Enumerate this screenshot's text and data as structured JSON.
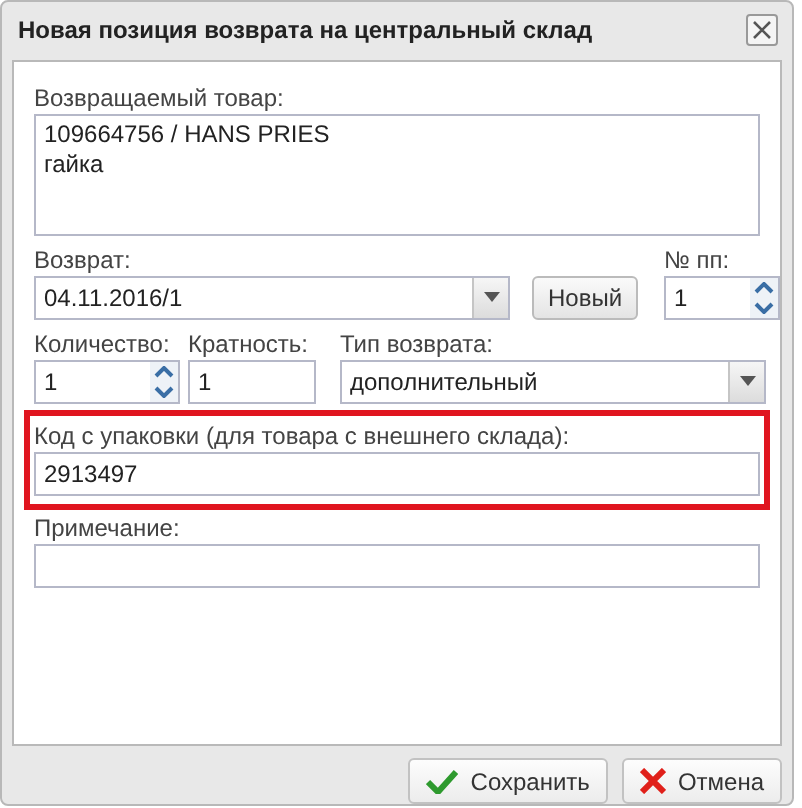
{
  "window": {
    "title": "Новая позиция возврата на центральный склад"
  },
  "product": {
    "label": "Возвращаемый товар:",
    "lines": [
      "109664756 / HANS PRIES",
      "гайка"
    ]
  },
  "return": {
    "label": "Возврат:",
    "value": "04.11.2016/1",
    "new_button": "Новый"
  },
  "number": {
    "label": "№ пп:",
    "value": "1"
  },
  "quantity": {
    "label": "Количество:",
    "value": "1"
  },
  "multiplicity": {
    "label": "Кратность:",
    "value": "1"
  },
  "return_type": {
    "label": "Тип возврата:",
    "value": "дополнительный"
  },
  "package_code": {
    "label": "Код с упаковки (для товара с внешнего склада):",
    "value": "2913497",
    "highlighted": true
  },
  "note": {
    "label": "Примечание:"
  },
  "buttons": [
    {
      "kind": "save",
      "label": "Сохранить"
    },
    {
      "kind": "cancel",
      "label": "Отмена"
    }
  ]
}
